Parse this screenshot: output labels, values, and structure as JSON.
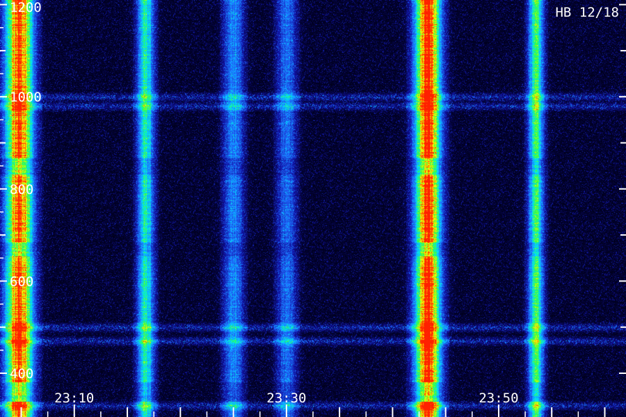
{
  "chart_data": {
    "type": "heatmap",
    "title": "",
    "annotation": "HB 12/18",
    "xlabel": "",
    "ylabel": "",
    "colormap": [
      "#00001a",
      "#1010a0",
      "#1f6cff",
      "#00e0ff",
      "#30ff40",
      "#ffff00",
      "#ff2000"
    ],
    "y_axis": {
      "range": [
        305,
        1210
      ],
      "major_ticks": [
        400,
        600,
        800,
        1000,
        1200
      ],
      "tick_labels": [
        "400",
        "600",
        "800",
        "1000",
        "1200"
      ],
      "minor_step": 100
    },
    "x_axis": {
      "range_minutes": [
        1383,
        1442
      ],
      "tick_labels": [
        "23:10",
        "23:30",
        "23:50"
      ],
      "label_minutes": [
        1390,
        1410,
        1430
      ],
      "minor_step_minutes": 5
    },
    "bands": [
      {
        "center_minute": 1384.8,
        "width_minutes": 3.2,
        "intensity": 0.95
      },
      {
        "center_minute": 1396.7,
        "width_minutes": 2.0,
        "intensity": 0.5
      },
      {
        "center_minute": 1405.0,
        "width_minutes": 2.4,
        "intensity": 0.32
      },
      {
        "center_minute": 1410.0,
        "width_minutes": 2.4,
        "intensity": 0.28
      },
      {
        "center_minute": 1423.3,
        "width_minutes": 3.0,
        "intensity": 0.98
      },
      {
        "center_minute": 1433.5,
        "width_minutes": 1.8,
        "intensity": 0.58
      }
    ],
    "interference_lines_y": [
      1000,
      980,
      500,
      470,
      330
    ]
  }
}
